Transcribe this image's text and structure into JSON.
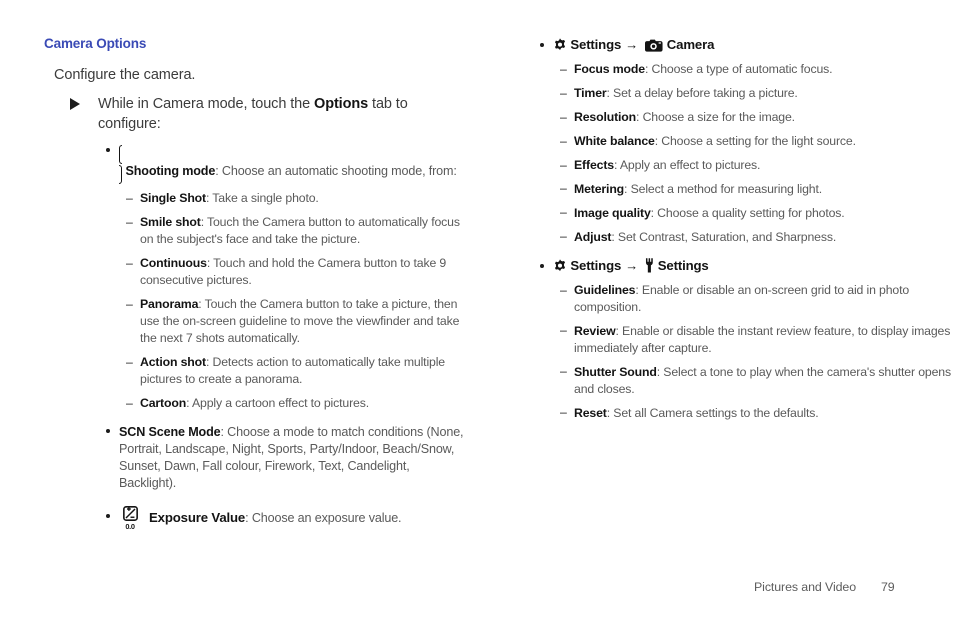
{
  "document": {
    "heading": "Camera Options",
    "intro": "Configure the camera."
  },
  "left_column": {
    "instruction": {
      "text_before": "While in Camera mode, touch the ",
      "bold": "Options",
      "text_after": " tab to configure:"
    },
    "shooting_mode": {
      "icon": "shooting-mode-icon",
      "term": "Shooting mode",
      "desc": ": Choose an automatic shooting mode, from:",
      "modes": [
        {
          "term": "Single Shot",
          "desc": ": Take a single photo."
        },
        {
          "term": "Smile shot",
          "desc": ": Touch the Camera button to automatically focus on the subject's face and take the picture."
        },
        {
          "term": "Continuous",
          "desc": ": Touch and hold the Camera button to take 9 consecutive pictures."
        },
        {
          "term": "Panorama",
          "desc": ": Touch the Camera button to take a picture, then use the on-screen guideline to move the viewfinder and take the next 7 shots automatically."
        },
        {
          "term": "Action shot",
          "desc": ": Detects action to automatically take multiple pictures to create a panorama."
        },
        {
          "term": "Cartoon",
          "desc": ": Apply a cartoon effect to pictures."
        }
      ]
    },
    "scene_mode": {
      "term": "SCN Scene Mode",
      "desc": ": Choose a mode to match conditions (None, Portrait, Landscape, Night, Sports, Party/Indoor, Beach/Snow, Sunset, Dawn, Fall colour, Firework, Text, Candelight, Backlight)."
    },
    "exposure_value": {
      "icon": "exposure-value-icon",
      "icon_label": "0.0",
      "term": "Exposure Value",
      "desc": ": Choose an exposure value."
    }
  },
  "right_column": {
    "settings_camera": {
      "gear_icon": "gear-icon",
      "label_1": "Settings",
      "arrow": "→",
      "target_icon": "camera-icon",
      "label_2": "Camera",
      "items": [
        {
          "term": "Focus mode",
          "desc": ": Choose a type of automatic focus."
        },
        {
          "term": "Timer",
          "desc": ": Set a delay before taking a picture."
        },
        {
          "term": "Resolution",
          "desc": ": Choose a size for the image."
        },
        {
          "term": "White balance",
          "desc": ": Choose a setting for the light source."
        },
        {
          "term": "Effects",
          "desc": ": Apply an effect to pictures."
        },
        {
          "term": "Metering",
          "desc": ": Select a method for measuring light."
        },
        {
          "term": "Image quality",
          "desc": ": Choose a quality setting for photos."
        },
        {
          "term": "Adjust",
          "desc": ": Set Contrast, Saturation, and Sharpness."
        }
      ]
    },
    "settings_settings": {
      "gear_icon": "gear-icon",
      "label_1": "Settings",
      "arrow": "→",
      "target_icon": "wrench-icon",
      "label_2": "Settings",
      "items": [
        {
          "term": "Guidelines",
          "desc": ": Enable or disable an on-screen grid to aid in photo composition."
        },
        {
          "term": "Review",
          "desc": ": Enable or disable the instant review feature, to display images immediately after capture."
        },
        {
          "term": "Shutter Sound",
          "desc": ": Select a tone to play when the camera's shutter opens and closes."
        },
        {
          "term": "Reset",
          "desc": ": Set all Camera settings to the defaults."
        }
      ]
    }
  },
  "footer": {
    "chapter": "Pictures and Video",
    "page_number": "79"
  },
  "colors": {
    "heading": "#3a4ab5",
    "body": "#5a5a5a",
    "term": "#141414"
  }
}
